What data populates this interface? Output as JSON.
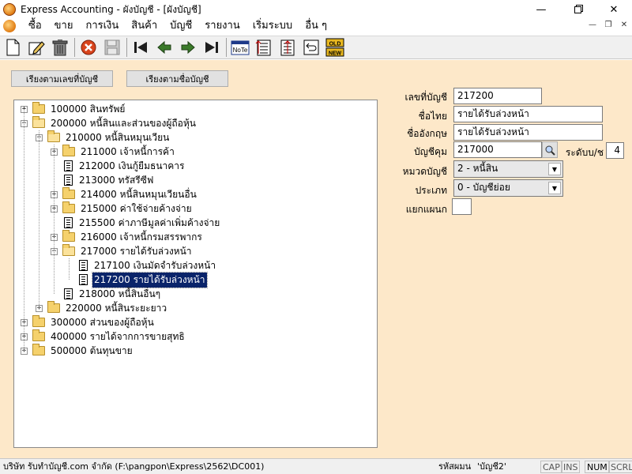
{
  "window": {
    "title": "Express Accounting - ผังบัญชี - [ผังบัญชี]",
    "minimize_icon": "minimize-icon",
    "maximize_icon": "restore-icon",
    "close_icon": "close-icon"
  },
  "menu": {
    "items": [
      "ซื้อ",
      "ขาย",
      "การเงิน",
      "สินค้า",
      "บัญชี",
      "รายงาน",
      "เริ่มระบบ",
      "อื่น ๆ"
    ]
  },
  "toolbar": {
    "buttons": [
      "new-icon",
      "edit-icon",
      "delete-icon",
      "cancel-icon",
      "save-icon",
      "first-icon",
      "previous-icon",
      "next-icon",
      "last-icon",
      "note-icon",
      "list-icon",
      "sort-icon",
      "undo-icon",
      "old-new-icon"
    ],
    "note_label": "NoTe",
    "old_label": "OLD",
    "new_label": "NEW"
  },
  "sort_buttons": {
    "by_number": "เรียงตามเลขที่บัญชี",
    "by_name": "เรียงตามชื่อบัญชี"
  },
  "tree": {
    "nodes": [
      {
        "code_name": "100000 สินทรัพย์",
        "level": 0,
        "type": "folder",
        "state": "collapsed"
      },
      {
        "code_name": "200000 หนี้สินและส่วนของผู้ถือหุ้น",
        "level": 0,
        "type": "folder",
        "state": "expanded"
      },
      {
        "code_name": "210000 หนี้สินหมุนเวียน",
        "level": 1,
        "type": "folder",
        "state": "expanded"
      },
      {
        "code_name": "211000 เจ้าหนี้การค้า",
        "level": 2,
        "type": "folder",
        "state": "collapsed"
      },
      {
        "code_name": "212000 เงินกู้ยืมธนาคาร",
        "level": 2,
        "type": "doc",
        "state": "leaf"
      },
      {
        "code_name": "213000 ทรัสรีซีฟ",
        "level": 2,
        "type": "doc",
        "state": "leaf"
      },
      {
        "code_name": "214000 หนี้สินหมุนเวียนอื่น",
        "level": 2,
        "type": "folder",
        "state": "collapsed"
      },
      {
        "code_name": "215000 ค่าใช้จ่ายค้างจ่าย",
        "level": 2,
        "type": "folder",
        "state": "collapsed"
      },
      {
        "code_name": "215500 ค่าภาษีมูลค่าเพิ่มค้างจ่าย",
        "level": 2,
        "type": "doc",
        "state": "leaf"
      },
      {
        "code_name": "216000 เจ้าหนี้กรมสรรพากร",
        "level": 2,
        "type": "folder",
        "state": "collapsed"
      },
      {
        "code_name": "217000 รายได้รับล่วงหน้า",
        "level": 2,
        "type": "folder",
        "state": "expanded"
      },
      {
        "code_name": "217100 เงินมัดจำรับล่วงหน้า",
        "level": 3,
        "type": "doc",
        "state": "leaf"
      },
      {
        "code_name": "217200 รายได้รับล่วงหน้า",
        "level": 3,
        "type": "doc",
        "state": "selected"
      },
      {
        "code_name": "218000 หนี้สินอื่นๆ",
        "level": 2,
        "type": "doc",
        "state": "leaf"
      },
      {
        "code_name": "220000 หนี้สินระยะยาว",
        "level": 1,
        "type": "folder",
        "state": "collapsed"
      },
      {
        "code_name": "300000 ส่วนของผู้ถือหุ้น",
        "level": 0,
        "type": "folder",
        "state": "collapsed"
      },
      {
        "code_name": "400000 รายได้จากการขายสุทธิ",
        "level": 0,
        "type": "folder",
        "state": "collapsed"
      },
      {
        "code_name": "500000 ต้นทุนขาย",
        "level": 0,
        "type": "folder",
        "state": "collapsed"
      }
    ]
  },
  "form": {
    "account_no_label": "เลขที่บัญชี",
    "account_no": "217200",
    "thai_name_label": "ชื่อไทย",
    "thai_name": "รายได้รับล่วงหน้า",
    "eng_name_label": "ชื่ออังกฤษ",
    "eng_name": "รายได้รับล่วงหน้า",
    "control_acc_label": "บัญชีคุม",
    "control_acc": "217000",
    "level_label": "ระดับบ/ช",
    "level": "4",
    "category_label": "หมวดบัญชี",
    "category": "2 - หนี้สิน",
    "type_label": "ประเภท",
    "type": "0 - บัญชีย่อย",
    "dept_label": "แยกแผนก",
    "dept": ""
  },
  "status": {
    "company": "บริษัท รับทำบัญชี.com จำกัด (F:\\pangpon\\Express\\2562\\DC001)",
    "user_label": "รหัสผมน",
    "user": "'บัญชี2'",
    "cap": "CAP",
    "ins": "INS",
    "num": "NUM",
    "scrl": "SCRL"
  }
}
